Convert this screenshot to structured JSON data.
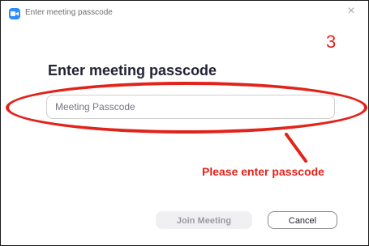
{
  "window": {
    "title": "Enter meeting passcode",
    "app_icon": "camera-icon",
    "close_icon": "close-icon",
    "close_glyph": "×"
  },
  "dialog": {
    "heading": "Enter meeting passcode",
    "passcode_placeholder": "Meeting Passcode",
    "passcode_value": "",
    "join_label": "Join Meeting",
    "cancel_label": "Cancel"
  },
  "annotation": {
    "step_number": "3",
    "text": "Please enter passcode",
    "color": "#e2231a"
  },
  "colors": {
    "accent": "#2d8cff",
    "annotation": "#e2231a"
  }
}
